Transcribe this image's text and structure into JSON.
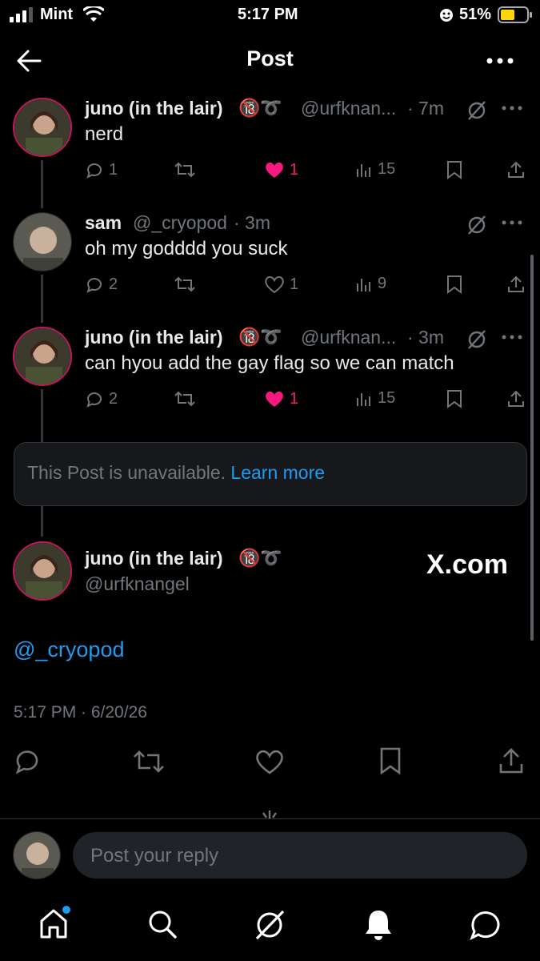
{
  "status_bar": {
    "carrier": "Mint",
    "time": "5:17 PM",
    "battery": "51%"
  },
  "header": {
    "title": "Post"
  },
  "thread": [
    {
      "name": "juno (in the lair)",
      "handle": "@urfknan...",
      "time": "· 7m",
      "text": "nerd",
      "replies": "1",
      "likes": "1",
      "views": "15",
      "liked": true
    },
    {
      "name": "sam",
      "handle": "@_cryopod",
      "time": "· 3m",
      "text": "oh my godddd you suck",
      "replies": "2",
      "likes": "1",
      "views": "9",
      "liked": false
    },
    {
      "name": "juno (in the lair)",
      "handle": "@urfknan...",
      "time": "· 3m",
      "text": "can hyou add the gay flag so we can match",
      "replies": "2",
      "likes": "1",
      "views": "15",
      "liked": true
    }
  ],
  "unavailable": {
    "text": "This Post is unavailable.",
    "link": "Learn more"
  },
  "main_post": {
    "name": "juno (in the lair)",
    "handle": "@urfknangel",
    "watermark": "X.com",
    "mention": "@_cryopod",
    "timestamp": "5:17 PM · 6/20/26"
  },
  "reply": {
    "placeholder": "Post your reply"
  },
  "icons": [
    "back-arrow-icon",
    "more-icon",
    "reply-icon",
    "retweet-icon",
    "heart-icon",
    "views-icon",
    "bookmark-icon",
    "share-icon",
    "grok-icon",
    "home-icon",
    "search-icon",
    "bell-icon",
    "messages-icon"
  ],
  "colors": {
    "accent": "#1d9bf0",
    "like": "#f91880",
    "muted": "#71767b"
  }
}
